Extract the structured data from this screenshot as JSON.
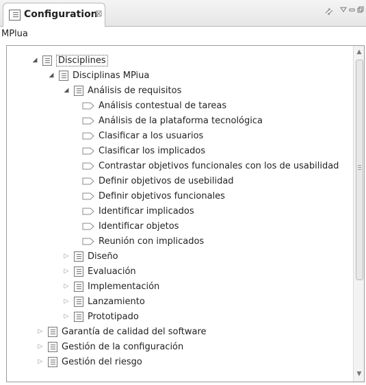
{
  "view": {
    "tab_title": "Configuration",
    "tab_close": "⊠",
    "subtitle": "MPlua",
    "toolbar_icons": [
      "sync-icon",
      "view-menu-icon",
      "minimize-icon",
      "maximize-icon"
    ]
  },
  "tree": {
    "root": "Disciplines",
    "group": "Disciplinas MPiua",
    "expanded_discipline": "Análisis de requisitos",
    "tasks": [
      "Análisis contestual de tareas",
      "Análisis de la plataforma tecnológica",
      "Clasificar a los usuarios",
      "Clasificar los implicados",
      "Contrastar objetivos funcionales con los de usabilidad",
      "Definir objetivos de usebilidad",
      "Definir objetivos funcionales",
      "Identificar implicados",
      "Identificar objetos",
      "Reunión con implicados"
    ],
    "disciplines": [
      "Diseño",
      "Evaluación",
      "Implementación",
      "Lanzamiento",
      "Prototipado"
    ],
    "other_groups": [
      "Garantía de calidad del software",
      "Gestión de la configuración",
      "Gestión del riesgo"
    ]
  },
  "colors": {
    "panel_border": "#9a9a9a",
    "icon_stroke": "#777777",
    "text": "#222222"
  }
}
